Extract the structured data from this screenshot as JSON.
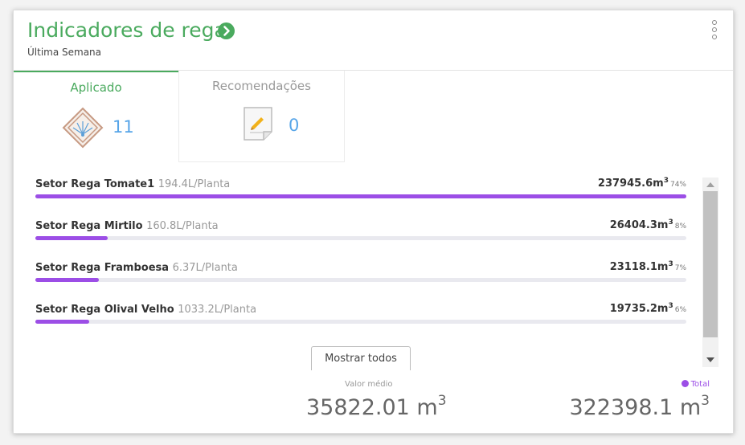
{
  "header": {
    "title": "Indicadores de rega",
    "subtitle": "Última Semana",
    "icons": {
      "navigate": "chevron-right-circle-icon",
      "menu": "kebab-menu-icon"
    }
  },
  "tabs": [
    {
      "label": "Aplicado",
      "count": "11",
      "icon": "sprinkler-icon",
      "active": true
    },
    {
      "label": "Recomendações",
      "count": "0",
      "icon": "note-pencil-icon",
      "active": false
    }
  ],
  "sectors": [
    {
      "name": "Setor Rega Tomate1",
      "rate": "194.4L/Planta",
      "volume": "237945.6m",
      "unit_sup": "3",
      "percent": "74%",
      "fill": 1.0
    },
    {
      "name": "Setor Rega Mirtilo",
      "rate": "160.8L/Planta",
      "volume": "26404.3m",
      "unit_sup": "3",
      "percent": "8%",
      "fill": 0.111
    },
    {
      "name": "Setor Rega Framboesa",
      "rate": "6.37L/Planta",
      "volume": "23118.1m",
      "unit_sup": "3",
      "percent": "7%",
      "fill": 0.097
    },
    {
      "name": "Setor Rega Olival Velho",
      "rate": "1033.2L/Planta",
      "volume": "19735.2m",
      "unit_sup": "3",
      "percent": "6%",
      "fill": 0.083
    }
  ],
  "show_all_label": "Mostrar todos",
  "summary": {
    "average_label": "Valor médio",
    "average_value": "35822.01 m",
    "average_unit_sup": "3",
    "total_label": "Total",
    "total_value": "322398.1 m",
    "total_unit_sup": "3"
  },
  "colors": {
    "accent": "#4aaa5e",
    "bar": "#9c4ee6",
    "count": "#57a5e8"
  }
}
